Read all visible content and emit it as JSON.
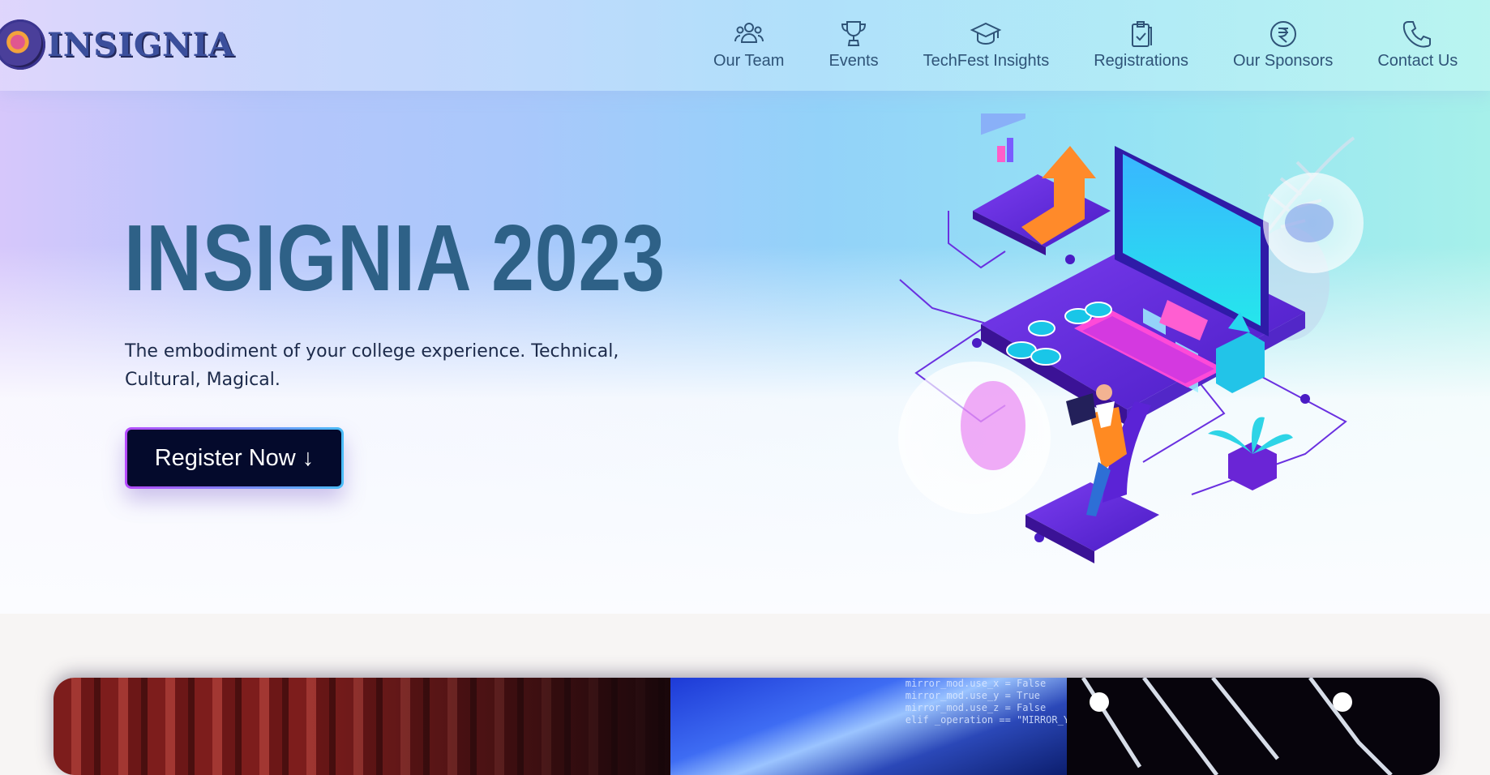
{
  "brand": {
    "name": "INSIGNIA"
  },
  "nav": {
    "items": [
      {
        "label": "Our Team",
        "icon": "team-icon"
      },
      {
        "label": "Events",
        "icon": "trophy-icon"
      },
      {
        "label": "TechFest Insights",
        "icon": "graduation-cap-icon"
      },
      {
        "label": "Registrations",
        "icon": "clipboard-check-icon"
      },
      {
        "label": "Our Sponsors",
        "icon": "rupee-icon"
      },
      {
        "label": "Contact Us",
        "icon": "phone-icon"
      }
    ]
  },
  "hero": {
    "title": "INSIGNIA 2023",
    "subtitle": "The embodiment of your college experience. Technical, Cultural, Magical.",
    "cta_label": "Register Now ↓"
  },
  "colors": {
    "title": "#2e6187",
    "nav_text": "#2f5478",
    "button_bg": "#040a2c",
    "button_border_start": "#b64bff",
    "button_border_end": "#4bbdf7",
    "illustration_purple": "#5b23d6"
  },
  "gallery": {
    "code_lines": [
      "mirror_mod.use_x = False",
      "mirror_mod.use_y = True",
      "mirror_mod.use_z = False",
      "elif _operation == \"MIRROR_Y\""
    ]
  }
}
